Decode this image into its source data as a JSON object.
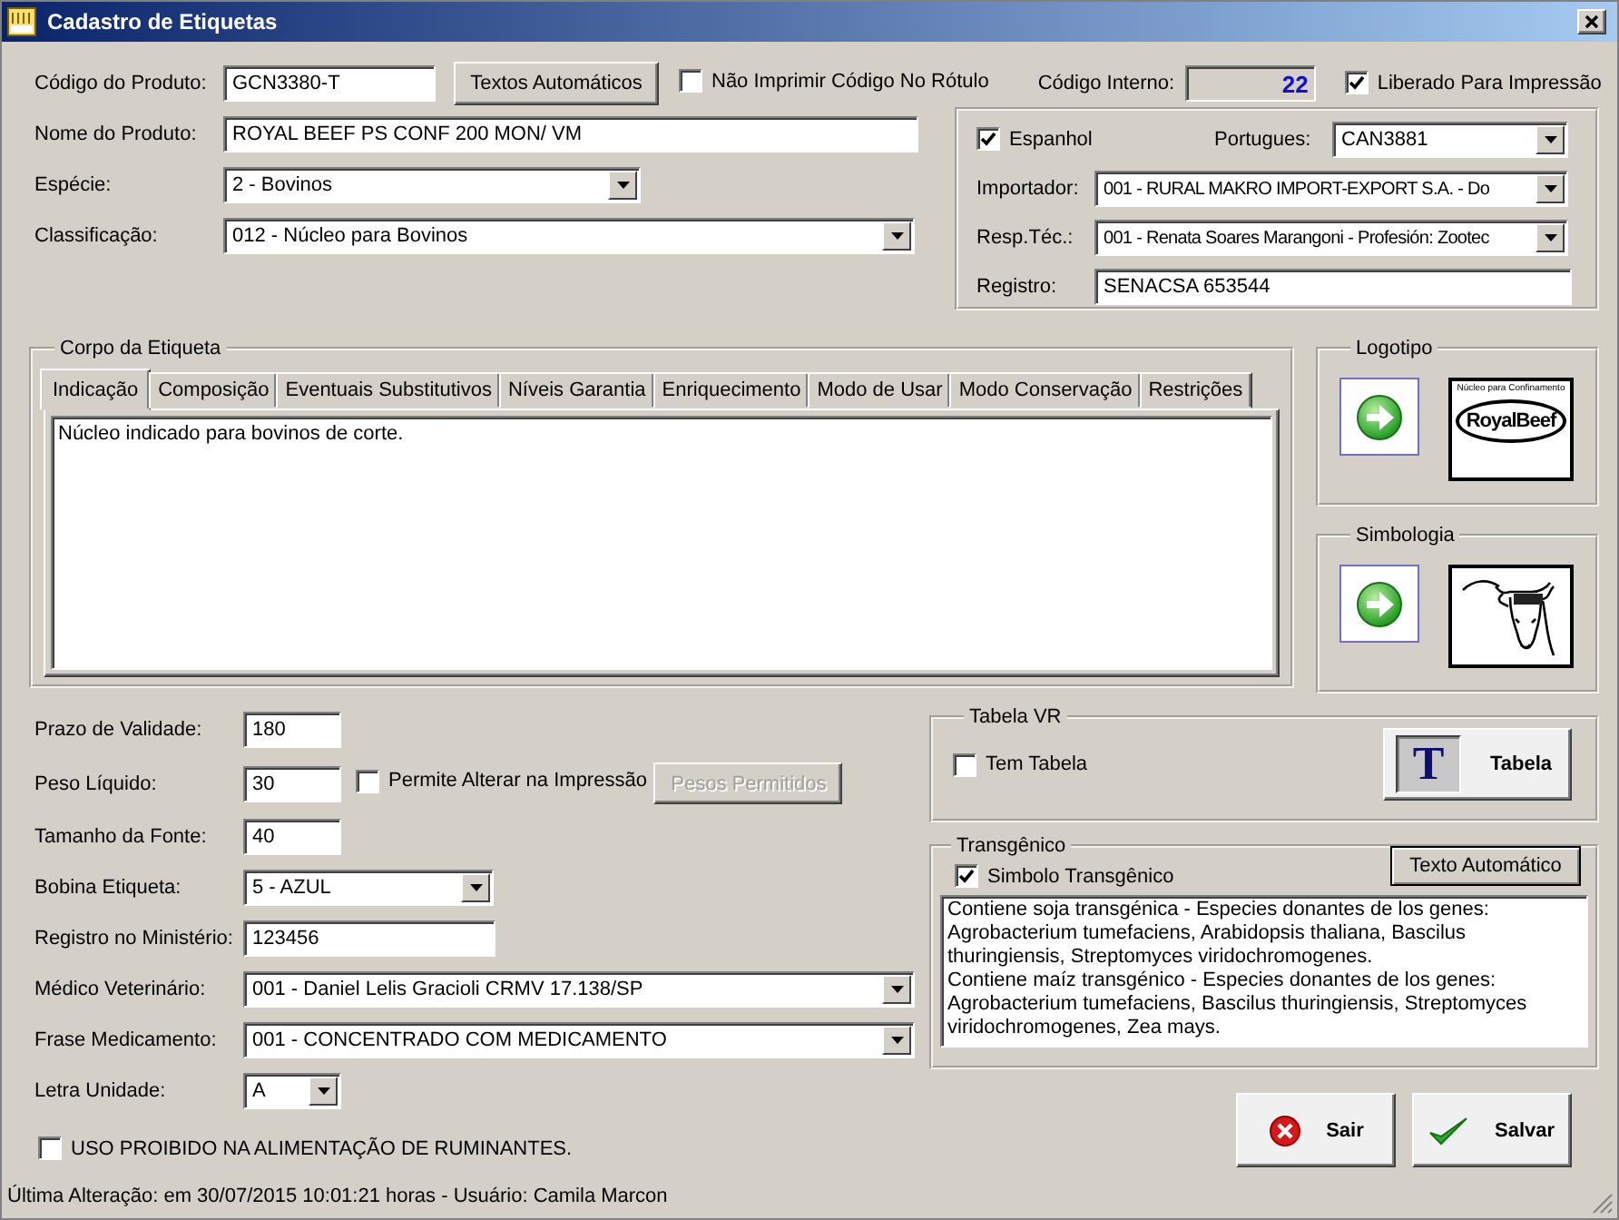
{
  "window": {
    "title": "Cadastro de Etiquetas"
  },
  "product": {
    "code_label": "Código do Produto:",
    "code": "GCN3380-T",
    "auto_texts_button": "Textos Automáticos",
    "no_print_code": {
      "label": "Não Imprimir Código No Rótulo",
      "checked": false
    },
    "internal_code_label": "Código Interno:",
    "internal_code": "22",
    "released": {
      "label": "Liberado Para Impressão",
      "checked": true
    },
    "fields": [
      {
        "label": "Nome do Produto:",
        "value": "ROYAL BEEF PS CONF 200 MON/ VM",
        "kind": "text"
      },
      {
        "label": "Espécie:",
        "value": "2 - Bovinos",
        "kind": "select"
      },
      {
        "label": "Classificação:",
        "value": "012 - Núcleo para Bovinos",
        "kind": "select"
      }
    ]
  },
  "spanish": {
    "checkbox": {
      "label": "Espanhol",
      "checked": true
    },
    "portugues_label": "Portugues:",
    "portugues": "CAN3881",
    "fields": [
      {
        "label": "Importador:",
        "value": "001 - RURAL MAKRO IMPORT-EXPORT S.A. - Do",
        "kind": "select"
      },
      {
        "label": "Resp.Téc.:",
        "value": "001 - Renata Soares Marangoni - Profesión: Zootec",
        "kind": "select"
      },
      {
        "label": "Registro:",
        "value": "SENACSA 653544",
        "kind": "text"
      }
    ]
  },
  "label_body": {
    "title": "Corpo da Etiqueta",
    "tabs": [
      {
        "label": "Indicação",
        "selected": true
      },
      {
        "label": "Composição",
        "selected": false
      },
      {
        "label": "Eventuais Substitutivos",
        "selected": false
      },
      {
        "label": "Níveis Garantia",
        "selected": false
      },
      {
        "label": "Enriquecimento",
        "selected": false
      },
      {
        "label": "Modo de Usar",
        "selected": false
      },
      {
        "label": "Modo Conservação",
        "selected": false
      },
      {
        "label": "Restrições",
        "selected": false
      }
    ],
    "text": "Núcleo indicado para bovinos de corte."
  },
  "logo": {
    "title": "Logotipo",
    "caption": "Núcleo para Confinamento",
    "wordmark": "RoyalBeef"
  },
  "symbology": {
    "title": "Simbologia"
  },
  "form": [
    {
      "label": "Prazo de Validade:",
      "value": "180",
      "kind": "text"
    },
    {
      "label": "Peso Líquido:",
      "value": "30",
      "kind": "text",
      "checkbox": {
        "label": "Permite Alterar na Impressão",
        "checked": false
      },
      "button": {
        "label": "Pesos Permitidos",
        "disabled": true
      }
    },
    {
      "label": "Tamanho da Fonte:",
      "value": "40",
      "kind": "text"
    },
    {
      "label": "Bobina Etiqueta:",
      "value": "5 - AZUL",
      "kind": "select"
    },
    {
      "label": "Registro no Ministério:",
      "value": "123456",
      "kind": "text"
    },
    {
      "label": "Médico Veterinário:",
      "value": "001 - Daniel Lelis Gracioli CRMV 17.138/SP",
      "kind": "select"
    },
    {
      "label": "Frase Medicamento:",
      "value": "001 - CONCENTRADO COM MEDICAMENTO",
      "kind": "select"
    },
    {
      "label": "Letra Unidade:",
      "value": "A",
      "kind": "select"
    }
  ],
  "ruminant_warning": {
    "label": "USO PROIBIDO NA ALIMENTAÇÃO DE RUMINANTES.",
    "checked": false
  },
  "table_vr": {
    "title": "Tabela VR",
    "checkbox": {
      "label": "Tem Tabela",
      "checked": false
    },
    "button_icon": "T",
    "button": "Tabela"
  },
  "transgenic": {
    "title": "Transgênico",
    "checkbox": {
      "label": "Simbolo Transgênico",
      "checked": true
    },
    "button": "Texto Automático",
    "text": "Contiene soja transgénica - Especies donantes de los genes: Agrobacterium tumefaciens, Arabidopsis thaliana, Bascilus thuringiensis, Streptomyces viridochromogenes.\nContiene maíz transgénico - Especies donantes de los genes: Agrobacterium tumefaciens, Bascilus thuringiensis, Streptomyces viridochromogenes, Zea mays."
  },
  "buttons": [
    {
      "label": "Sair",
      "kind": "cancel"
    },
    {
      "label": "Salvar",
      "kind": "save"
    }
  ],
  "status_bar": "Última Alteração: em 30/07/2015 10:01:21 horas - Usuário: Camila Marcon"
}
